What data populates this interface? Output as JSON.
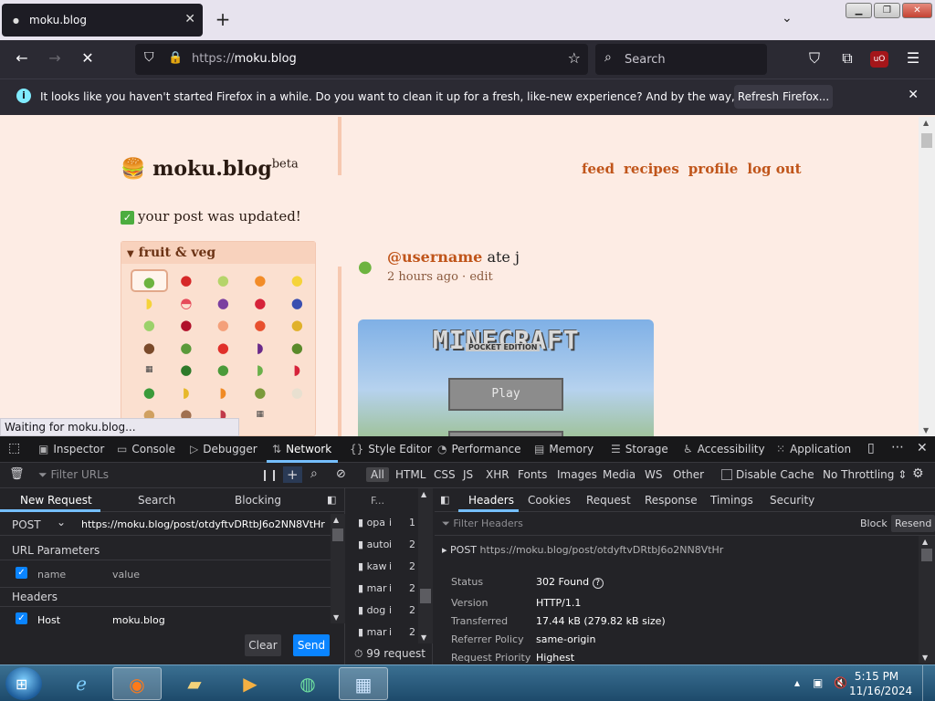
{
  "window": {
    "tab_title": "moku.blog",
    "url_scheme": "https://",
    "url_host": "moku.blog",
    "search_placeholder": "Search"
  },
  "notification": {
    "message": "It looks like you haven't started Firefox in a while. Do you want to clean it up for a fresh, like-new experience? And by the way, welcome back!",
    "button": "Refresh Firefox..."
  },
  "page": {
    "logo": "moku.blog",
    "logo_sup": "beta",
    "nav": [
      "feed",
      "recipes",
      "profile",
      "log out"
    ],
    "flash": "your post was updated!",
    "picker_title": "fruit & veg",
    "post_user": "@username",
    "post_action": "ate j",
    "post_time": "2 hours ago",
    "post_edit": "edit",
    "game_title": "MINECRAFT",
    "game_sub": "POCKET EDITION",
    "game_button": "Play",
    "status": "Waiting for moku.blog..."
  },
  "devtools": {
    "tabs": [
      "Inspector",
      "Console",
      "Debugger",
      "Network",
      "Style Editor",
      "Performance",
      "Memory",
      "Storage",
      "Accessibility",
      "Application"
    ],
    "filter_urls": "Filter URLs",
    "types": [
      "All",
      "HTML",
      "CSS",
      "JS",
      "XHR",
      "Fonts",
      "Images",
      "Media",
      "WS",
      "Other"
    ],
    "disable_cache": "Disable Cache",
    "throttling": "No Throttling",
    "req_tabs": [
      "New Request",
      "Search",
      "Blocking"
    ],
    "method": "POST",
    "req_url": "https://moku.blog/post/otdyftvDRtbJ6o2NN8VtHr",
    "url_params": "URL Parameters",
    "param_name": "name",
    "param_value": "value",
    "headers_title": "Headers",
    "header_name": "Host",
    "header_value": "moku.blog",
    "clear": "Clear",
    "send": "Send",
    "list_header": "F...",
    "list_items": [
      {
        "n": "opa",
        "a": "i",
        "c": "1"
      },
      {
        "n": "auto",
        "a": "i",
        "c": "2"
      },
      {
        "n": "kaw",
        "a": "i",
        "c": "2"
      },
      {
        "n": "mar",
        "a": "i",
        "c": "2"
      },
      {
        "n": "dog",
        "a": "i",
        "c": "2"
      },
      {
        "n": "mar",
        "a": "i",
        "c": "2"
      }
    ],
    "request_count": "99 request",
    "detail_tabs": [
      "Headers",
      "Cookies",
      "Request",
      "Response",
      "Timings",
      "Security"
    ],
    "filter_headers": "Filter Headers",
    "block": "Block",
    "resend": "Resend",
    "summary_method": "POST",
    "summary_url": "https://moku.blog/post/otdyftvDRtbJ6o2NN8VtHr",
    "fields": [
      {
        "k": "Status",
        "v": "302 Found"
      },
      {
        "k": "Version",
        "v": "HTTP/1.1"
      },
      {
        "k": "Transferred",
        "v": "17.44 kB (279.82 kB size)"
      },
      {
        "k": "Referrer Policy",
        "v": "same-origin"
      },
      {
        "k": "Request Priority",
        "v": "Highest"
      }
    ]
  },
  "taskbar": {
    "time": "5:15 PM",
    "date": "11/16/2024"
  }
}
